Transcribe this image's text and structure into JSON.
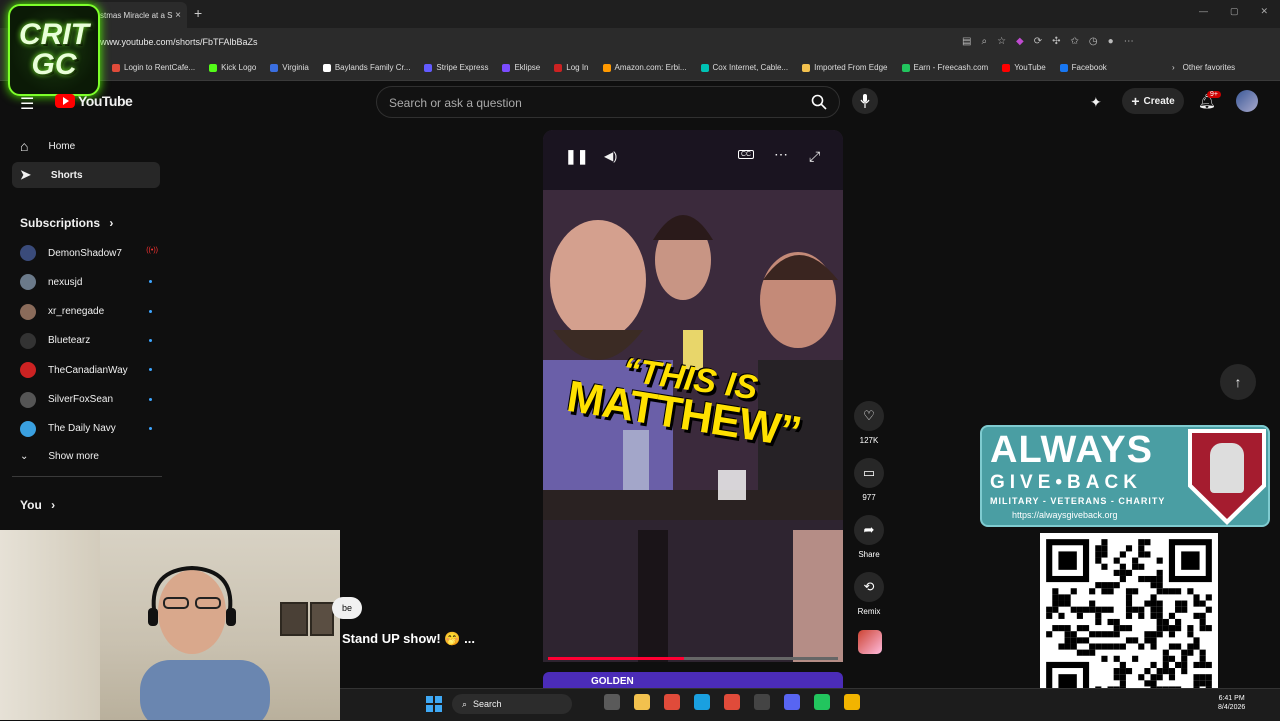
{
  "browser": {
    "tab_title": "stmas Miracle at a S",
    "tab_close": "×",
    "new_tab": "+",
    "url": "www.youtube.com/shorts/FbTFAlbBaZs",
    "bookmarks": [
      {
        "label": "Login to RentCafe...",
        "color": "#e04b3a"
      },
      {
        "label": "Kick Logo",
        "color": "#53fc18"
      },
      {
        "label": "Virginia",
        "color": "#3a6ee0"
      },
      {
        "label": "Baylands Family Cr...",
        "color": "#ffffff"
      },
      {
        "label": "Stripe Express",
        "color": "#635bff"
      },
      {
        "label": "Eklipse",
        "color": "#7b4cff"
      },
      {
        "label": "Log In",
        "color": "#cc2222"
      },
      {
        "label": "Amazon.com: Erbi...",
        "color": "#ff9900"
      },
      {
        "label": "Cox Internet, Cable...",
        "color": "#00c3b5"
      },
      {
        "label": "Imported From Edge",
        "color": "#f2c14e"
      },
      {
        "label": "Earn - Freecash.com",
        "color": "#22c55e"
      },
      {
        "label": "YouTube",
        "color": "#ff0000"
      },
      {
        "label": "Facebook",
        "color": "#1877f2"
      }
    ],
    "other_favorites": "Other favorites"
  },
  "overlay_logo": {
    "line1": "CRIT",
    "line2": "GC"
  },
  "youtube": {
    "logo_text": "YouTube",
    "search_placeholder": "Search or ask a question",
    "create_label": "Create",
    "notif_badge": "9+"
  },
  "sidebar": {
    "home": "Home",
    "shorts": "Shorts",
    "subscriptions": "Subscriptions",
    "subs": [
      {
        "name": "DemonShadow7",
        "color": "#3a4b7a",
        "live": true
      },
      {
        "name": "nexusjd",
        "color": "#6b7a8a",
        "live": false
      },
      {
        "name": "xr_renegade",
        "color": "#8a6b5a",
        "live": false
      },
      {
        "name": "Bluetearz",
        "color": "#333333",
        "live": false
      },
      {
        "name": "TheCanadianWay",
        "color": "#cc2222",
        "live": false
      },
      {
        "name": "SilverFoxSean",
        "color": "#555555",
        "live": false
      },
      {
        "name": "The Daily Navy",
        "color": "#3aa0e0",
        "live": false
      }
    ],
    "show_more": "Show more",
    "you": "You"
  },
  "short": {
    "caption_line1": "“THIS IS",
    "caption_line2": "MATTHEW”",
    "title_fragment": "Stand UP show! 🤭 ...",
    "chip_fragment": "be",
    "golden_label": "GOLDEN",
    "progress": 0.47,
    "likes": "127K",
    "comments": "977",
    "share": "Share",
    "remix": "Remix"
  },
  "agb": {
    "title": "ALWAYS",
    "sub": "GIVE•BACK",
    "tagline": "MILITARY - VETERANS - CHARITY",
    "url": "https://alwaysgiveback.org"
  },
  "taskbar": {
    "search": "Search",
    "time": "6:41 PM",
    "date": "8/4/2026",
    "icons": [
      "#5a5a5a",
      "#f2c14e",
      "#e04b3a",
      "#1aa0e0",
      "#e04b3a",
      "#444444",
      "#5865f2",
      "#22c55e",
      "#f2b400"
    ]
  }
}
